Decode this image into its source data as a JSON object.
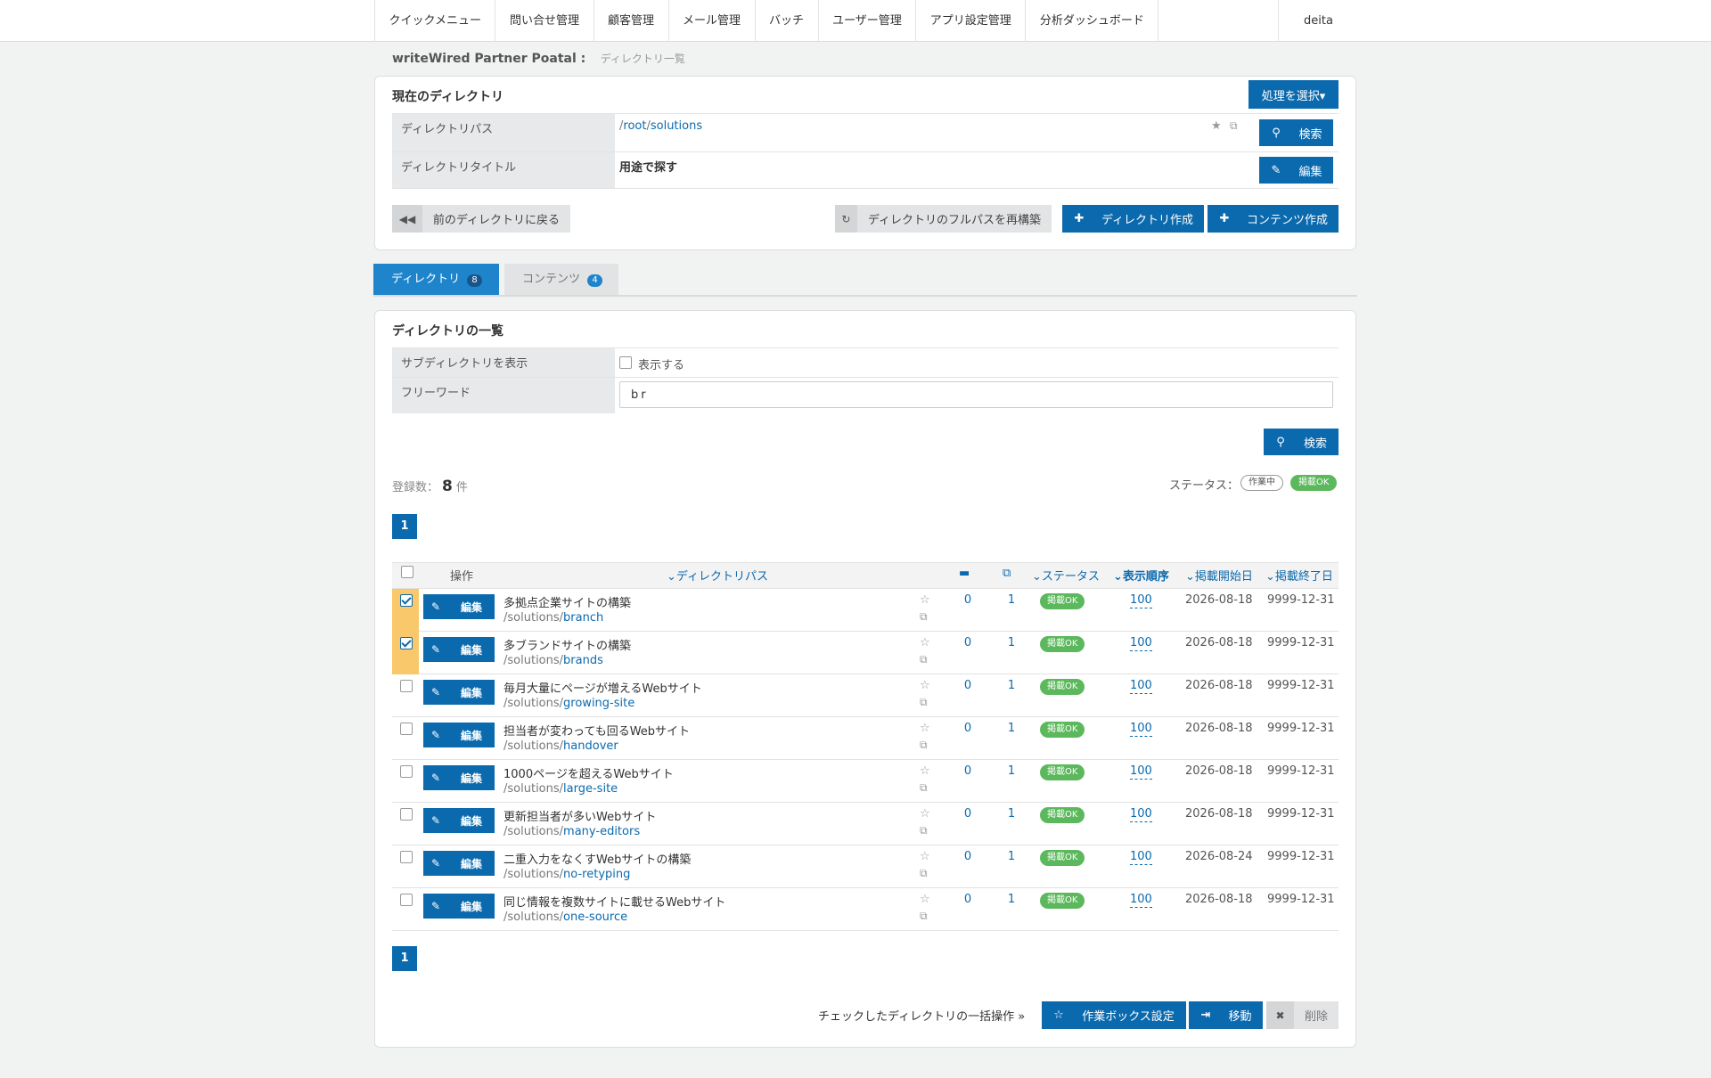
{
  "nav": {
    "items": [
      "クイックメニュー",
      "問い合せ管理",
      "顧客管理",
      "メール管理",
      "バッチ",
      "ユーザー管理",
      "アプリ設定管理",
      "分析ダッシュボード"
    ],
    "user": "deita"
  },
  "breadcrumb": {
    "site": "writeWired Partner Poatal :",
    "page": "ディレクトリ一覧"
  },
  "current_dir": {
    "title": "現在のディレクトリ",
    "action_select": "処理を選択▾",
    "path_label": "ディレクトリパス",
    "path_root": "root",
    "path_dir": "solutions",
    "search_btn": "検索",
    "title_label": "ディレクトリタイトル",
    "title_value": "用途で探す",
    "edit_btn": "編集",
    "back_btn": "前のディレクトリに戻る",
    "rebuild_btn": "ディレクトリのフルパスを再構築",
    "create_dir_btn": "ディレクトリ作成",
    "create_content_btn": "コンテンツ作成"
  },
  "tabs": [
    {
      "label": "ディレクトリ",
      "count": "8"
    },
    {
      "label": "コンテンツ",
      "count": "4"
    }
  ],
  "list": {
    "title": "ディレクトリの一覧",
    "sub_label": "サブディレクトリを表示",
    "sub_check": "表示する",
    "freeword_label": "フリーワード",
    "freeword_value": "br",
    "search_btn": "検索",
    "count_prefix": "登録数：",
    "count": "8",
    "count_suffix": "件",
    "status_label": "ステータス：",
    "status_working": "作業中",
    "status_ok": "掲載OK",
    "page": "1",
    "headers": {
      "op": "操作",
      "path": "ディレクトリパス",
      "status": "ステータス",
      "order": "表示順序",
      "start": "掲載開始日",
      "end": "掲載終了日"
    },
    "edit_label": "編集",
    "rows": [
      {
        "title": "多拠点企業サイトの構築",
        "parent": "solutions",
        "slug": "branch",
        "dirs": "0",
        "contents": "1",
        "status": "掲載OK",
        "order": "100",
        "start": "2026-08-18",
        "end": "9999-12-31",
        "checked": true
      },
      {
        "title": "多ブランドサイトの構築",
        "parent": "solutions",
        "slug": "brands",
        "dirs": "0",
        "contents": "1",
        "status": "掲載OK",
        "order": "100",
        "start": "2026-08-18",
        "end": "9999-12-31",
        "checked": true
      },
      {
        "title": "毎月大量にページが増えるWebサイト",
        "parent": "solutions",
        "slug": "growing-site",
        "dirs": "0",
        "contents": "1",
        "status": "掲載OK",
        "order": "100",
        "start": "2026-08-18",
        "end": "9999-12-31",
        "checked": false
      },
      {
        "title": "担当者が変わっても回るWebサイト",
        "parent": "solutions",
        "slug": "handover",
        "dirs": "0",
        "contents": "1",
        "status": "掲載OK",
        "order": "100",
        "start": "2026-08-18",
        "end": "9999-12-31",
        "checked": false
      },
      {
        "title": "1000ページを超えるWebサイト",
        "parent": "solutions",
        "slug": "large-site",
        "dirs": "0",
        "contents": "1",
        "status": "掲載OK",
        "order": "100",
        "start": "2026-08-18",
        "end": "9999-12-31",
        "checked": false
      },
      {
        "title": "更新担当者が多いWebサイト",
        "parent": "solutions",
        "slug": "many-editors",
        "dirs": "0",
        "contents": "1",
        "status": "掲載OK",
        "order": "100",
        "start": "2026-08-18",
        "end": "9999-12-31",
        "checked": false
      },
      {
        "title": "二重入力をなくすWebサイトの構築",
        "parent": "solutions",
        "slug": "no-retyping",
        "dirs": "0",
        "contents": "1",
        "status": "掲載OK",
        "order": "100",
        "start": "2026-08-24",
        "end": "9999-12-31",
        "checked": false
      },
      {
        "title": "同じ情報を複数サイトに載せるWebサイト",
        "parent": "solutions",
        "slug": "one-source",
        "dirs": "0",
        "contents": "1",
        "status": "掲載OK",
        "order": "100",
        "start": "2026-08-18",
        "end": "9999-12-31",
        "checked": false
      }
    ],
    "bulk_label": "チェックしたディレクトリの一括操作 »",
    "workbox_btn": "作業ボックス設定",
    "move_btn": "移動",
    "delete_btn": "削除"
  },
  "colors": {
    "primary": "#0b6aae",
    "ok": "#5cb85c",
    "highlight": "#f8c86a"
  }
}
